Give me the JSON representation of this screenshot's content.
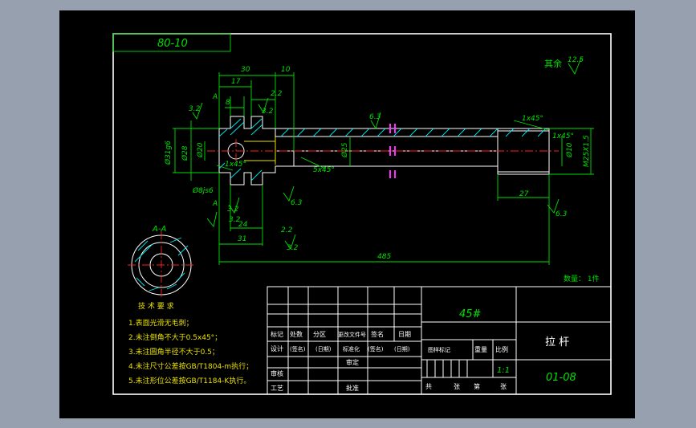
{
  "colors": {
    "background": "#96a0ae",
    "sheet": "#000000",
    "dims": "#00e000",
    "outline": "#ffffff",
    "center": "#ff2020",
    "hatch": "#00e5ee",
    "note": "#e8e000"
  },
  "drawing": {
    "tag": "80-10",
    "roughness_rest": "其余",
    "roughness_rest_value": "12.5",
    "section_label": "A-A",
    "section_mark": "A",
    "quantity": "数量：  1件",
    "dims": {
      "d30": "30",
      "d10": "10",
      "d17": "17",
      "d8": "8",
      "t22": "2.2",
      "t22b": "2.2",
      "r32a": "3.2",
      "r32b": "3.2",
      "r32c": "3.2",
      "r32d": "3.2",
      "r32e": "3.2",
      "r63a": "6.3",
      "r63b": "6.3",
      "r63c": "6.3",
      "ch1": "1x45°",
      "ch2": "1x45°",
      "ch3": "1x45°",
      "ch4": "5x45°",
      "d31": "Ø31g6",
      "d28": "Ø28",
      "d20": "Ø20",
      "d25": "Ø25",
      "d10b": "Ø10",
      "d8js6": "Ø8js6",
      "m25": "M25X1.5",
      "d24": "24",
      "d31b": "31",
      "d27": "27",
      "d485": "485"
    },
    "requirements": {
      "title": "技 术 要 求",
      "items": [
        "1.表面光滑无毛刺；",
        "2.未注倒角不大于0.5x45°；",
        "3.未注圆角半径不大于0.5；",
        "4.未注尺寸公差按GB/T1804-m执行；",
        "5.未注形位公差按GB/T1184-K执行。"
      ]
    }
  },
  "title_block": {
    "material": "45#",
    "part_name": "拉  杆",
    "drawing_no": "01-08",
    "scale": "1:1",
    "labels": {
      "mark": "标记",
      "count": "处数",
      "zone": "分区",
      "change_doc": "更改文件号",
      "sign": "签名",
      "date": "日期",
      "design": "设计",
      "sign2": "(签名)",
      "date2": "(日期)",
      "standard": "标准化",
      "sign3": "(签名)",
      "date3": "(日期)",
      "stage_mark": "图样标记",
      "weight": "重量",
      "ratio": "比例",
      "review": "审核",
      "process": "工艺",
      "check": "审定",
      "approve": "批准",
      "total": "共",
      "sheets": "张",
      "page_no": "第",
      "page": "张"
    }
  }
}
